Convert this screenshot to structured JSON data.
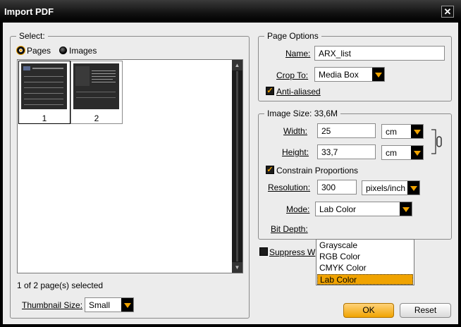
{
  "window": {
    "title": "Import PDF",
    "close_label": "✕"
  },
  "select": {
    "legend": "Select:",
    "radio_pages": "Pages",
    "radio_images": "Images",
    "selected_radio": "Pages",
    "thumbnails": [
      {
        "number": "1",
        "selected": true
      },
      {
        "number": "2",
        "selected": false
      }
    ],
    "status": "1 of 2 page(s) selected",
    "thumbnail_size_label": "Thumbnail Size:",
    "thumbnail_size_value": "Small"
  },
  "page_options": {
    "legend": "Page Options",
    "name_label": "Name:",
    "name_value": "ARX_list",
    "crop_label": "Crop To:",
    "crop_value": "Media Box",
    "anti_aliased_label": "Anti-aliased",
    "anti_aliased_checked": true
  },
  "image_size": {
    "legend": "Image Size: 33,6M",
    "width_label": "Width:",
    "width_value": "25",
    "width_unit": "cm",
    "height_label": "Height:",
    "height_value": "33,7",
    "height_unit": "cm",
    "constrain_label": "Constrain Proportions",
    "constrain_checked": true,
    "resolution_label": "Resolution:",
    "resolution_value": "300",
    "resolution_unit": "pixels/inch",
    "mode_label": "Mode:",
    "mode_value": "Lab Color",
    "mode_options": [
      "Grayscale",
      "RGB Color",
      "CMYK Color",
      "Lab Color"
    ],
    "bit_depth_label": "Bit Depth:"
  },
  "suppress_label_visible": "Suppress W",
  "buttons": {
    "ok": "OK",
    "reset": "Reset"
  },
  "colors": {
    "accent": "#f0a300",
    "titlebar": "#000000",
    "panel": "#ececec"
  }
}
